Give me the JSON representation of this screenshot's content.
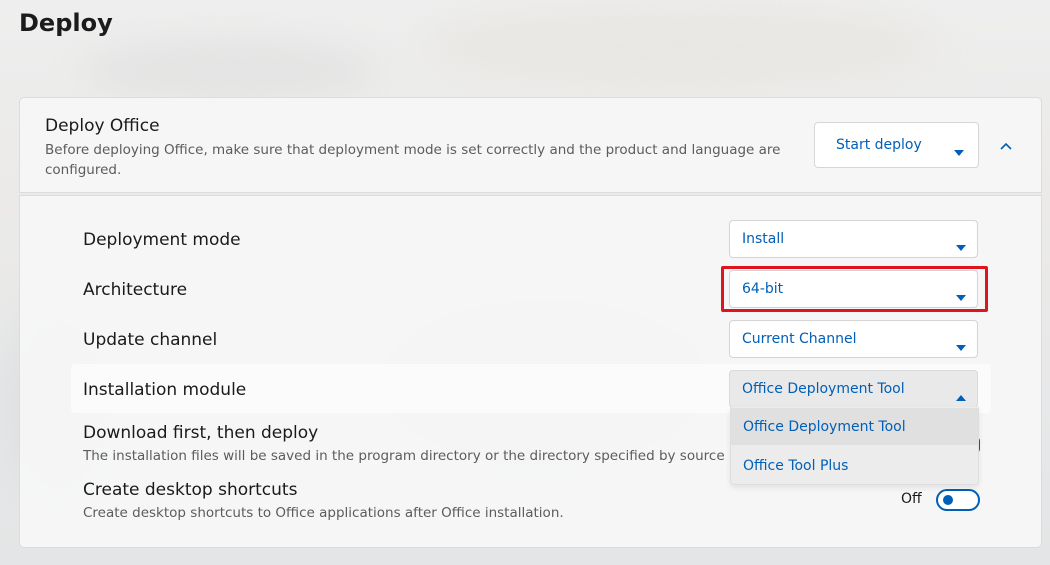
{
  "page": {
    "title": "Deploy"
  },
  "deploy_card": {
    "title": "Deploy Office",
    "description": "Before deploying Office, make sure that deployment mode is set correctly and the product and language are configured.",
    "start_button_label": "Start deploy"
  },
  "settings": {
    "deployment_mode": {
      "label": "Deployment mode",
      "value": "Install"
    },
    "architecture": {
      "label": "Architecture",
      "value": "64-bit"
    },
    "update_channel": {
      "label": "Update channel",
      "value": "Current Channel"
    },
    "installation_module": {
      "label": "Installation module",
      "value": "Office Deployment Tool",
      "options": [
        "Office Deployment Tool",
        "Office Tool Plus"
      ]
    },
    "download_first": {
      "title": "Download first, then deploy",
      "description": "The installation files will be saved in the program directory or the directory specified by source path."
    },
    "desktop_shortcuts": {
      "title": "Create desktop shortcuts",
      "description": "Create desktop shortcuts to Office applications after Office installation.",
      "toggle_label": "Off"
    }
  },
  "colors": {
    "accent": "#005fb8",
    "highlight": "#e0141e"
  },
  "icons": {
    "dropdown": "chevron-down-icon",
    "dropup": "chevron-up-icon"
  }
}
